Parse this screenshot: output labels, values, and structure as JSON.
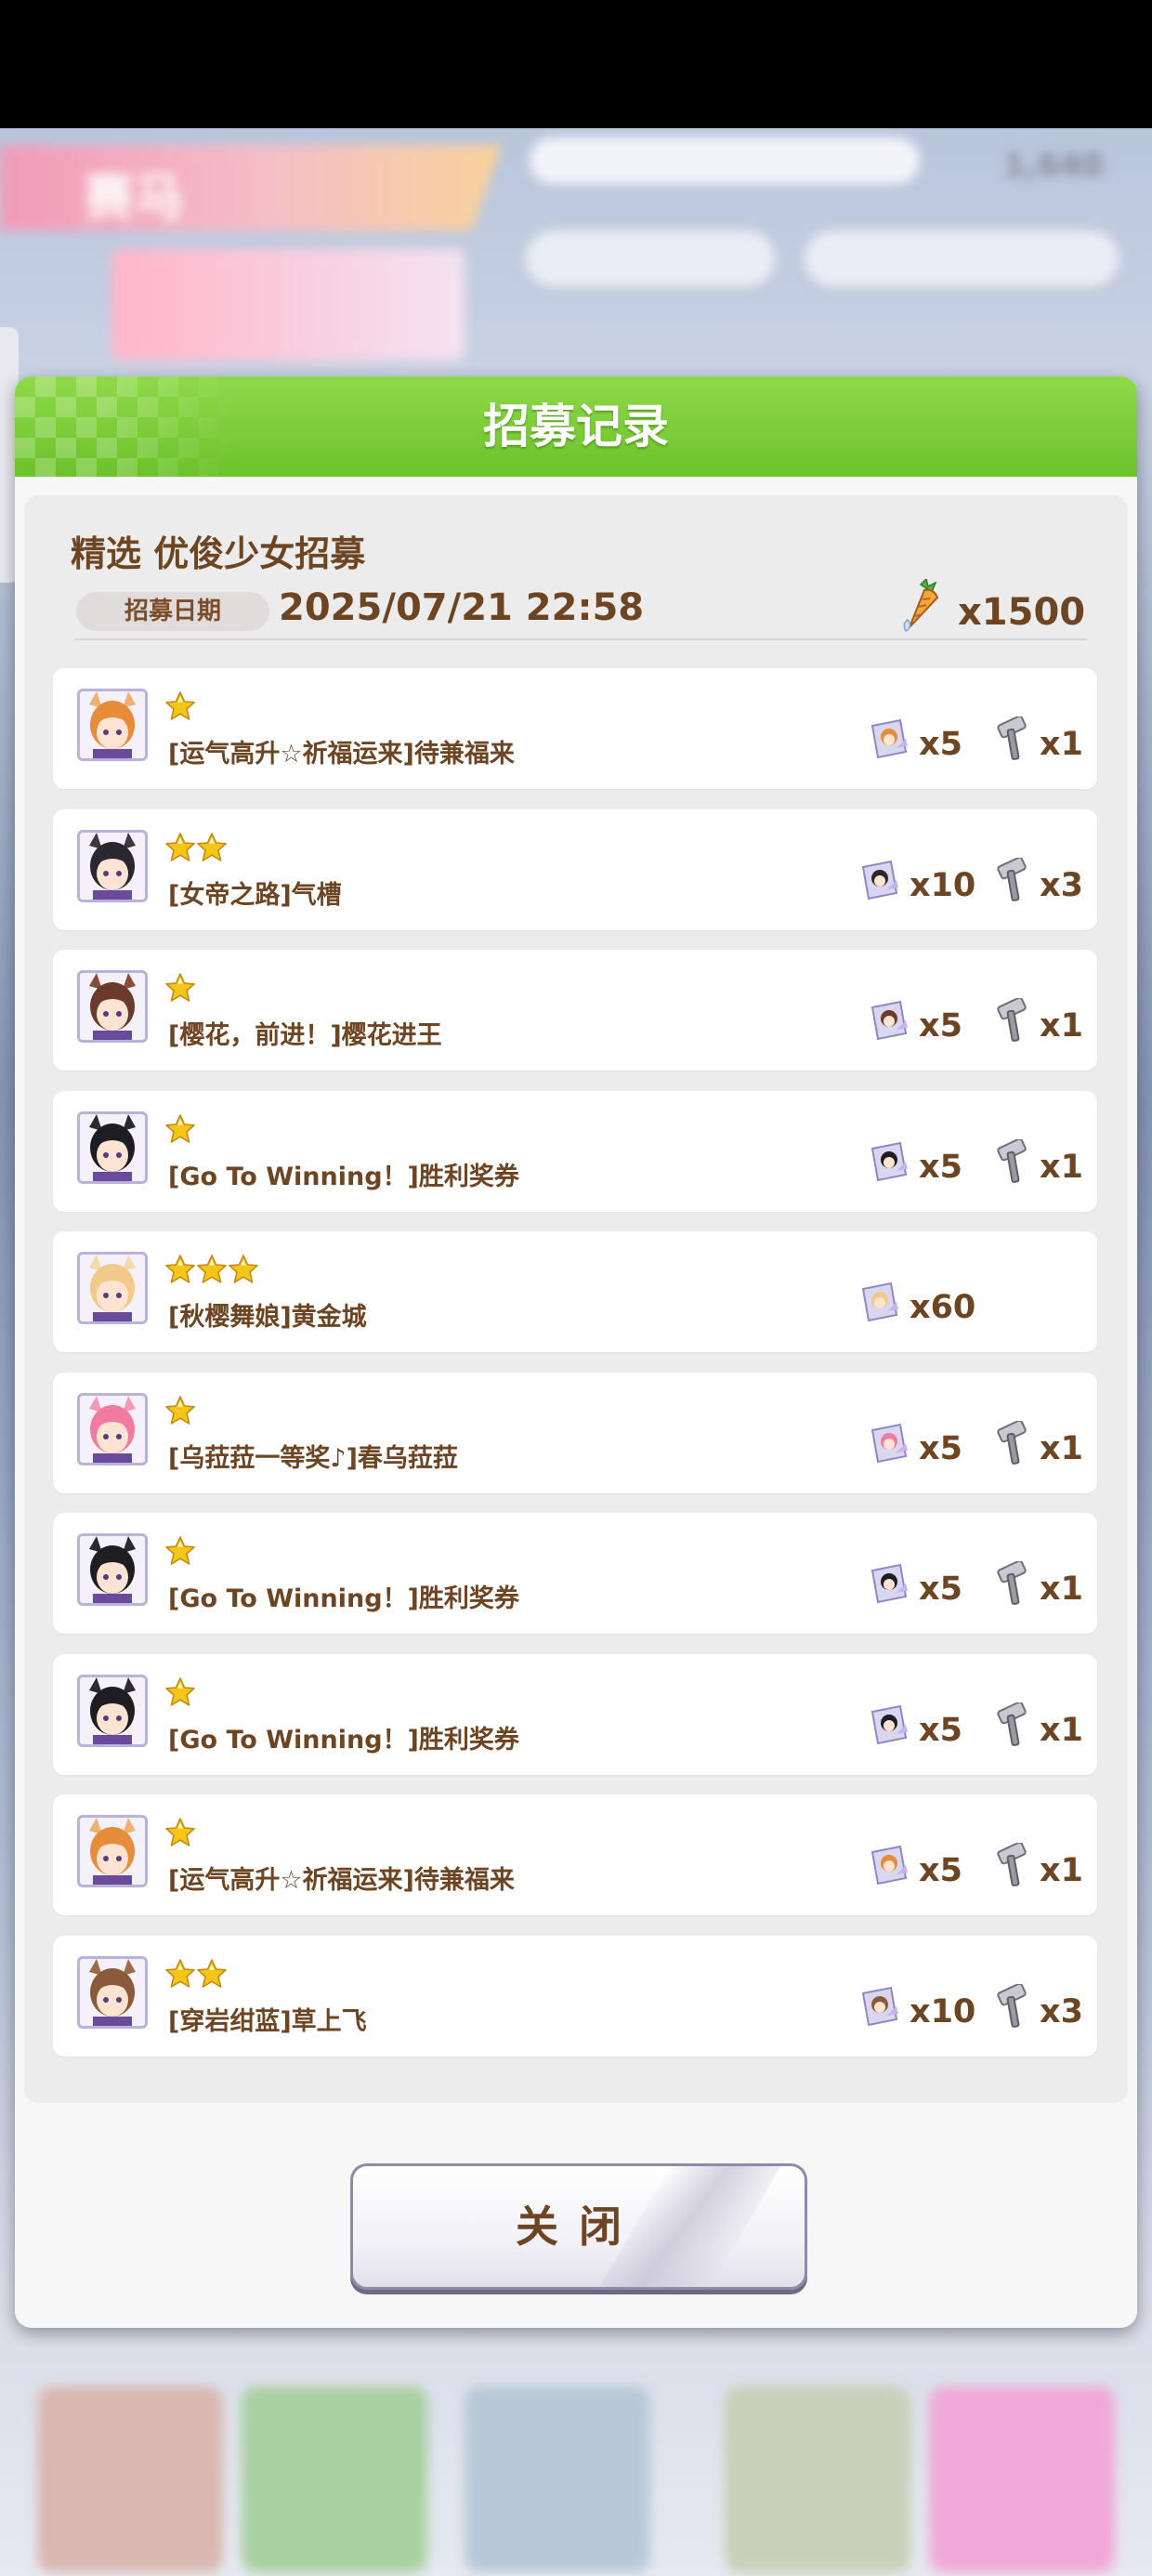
{
  "background": {
    "header_title": "赛马",
    "coin_count": "1,640"
  },
  "dialog": {
    "title": "招募记录",
    "banner_name": "精选 优俊少女招募",
    "date_label": "招募日期",
    "date_value": "2025/07/21 22:58",
    "cost": "x1500",
    "close_label": "关闭"
  },
  "records": [
    {
      "stars": 1,
      "name": "[运气高升☆祈福运来]待兼福来",
      "pieces": "x5",
      "hammers": "x1",
      "hair": "#e68c3a",
      "ear": "#f0b070"
    },
    {
      "stars": 2,
      "name": "[女帝之路]气槽",
      "pieces": "x10",
      "hammers": "x3",
      "hair": "#2b2730",
      "ear": "#3d3740"
    },
    {
      "stars": 1,
      "name": "[樱花，前进！]樱花进王",
      "pieces": "x5",
      "hammers": "x1",
      "hair": "#6b3a2a",
      "ear": "#8a4c36"
    },
    {
      "stars": 1,
      "name": "[Go To Winning！]胜利奖券",
      "pieces": "x5",
      "hammers": "x1",
      "hair": "#1d1d22",
      "ear": "#2a2a30"
    },
    {
      "stars": 3,
      "name": "[秋樱舞娘]黄金城",
      "pieces": "x60",
      "hammers": "",
      "hair": "#f2c98a",
      "ear": "#f6d9a8"
    },
    {
      "stars": 1,
      "name": "[乌菈菈一等奖♪]春乌菈菈",
      "pieces": "x5",
      "hammers": "x1",
      "hair": "#f07aa0",
      "ear": "#f29ab8"
    },
    {
      "stars": 1,
      "name": "[Go To Winning！]胜利奖券",
      "pieces": "x5",
      "hammers": "x1",
      "hair": "#1d1d22",
      "ear": "#2a2a30"
    },
    {
      "stars": 1,
      "name": "[Go To Winning！]胜利奖券",
      "pieces": "x5",
      "hammers": "x1",
      "hair": "#1d1d22",
      "ear": "#2a2a30"
    },
    {
      "stars": 1,
      "name": "[运气高升☆祈福运来]待兼福来",
      "pieces": "x5",
      "hammers": "x1",
      "hair": "#e68c3a",
      "ear": "#f0b070"
    },
    {
      "stars": 2,
      "name": "[穿岩绀蓝]草上飞",
      "pieces": "x10",
      "hammers": "x3",
      "hair": "#8a5a3a",
      "ear": "#a06c48"
    }
  ],
  "icons": {
    "cost": "carrot-icon",
    "pieces": "character-piece-icon",
    "hammers": "hammer-icon",
    "rarity": "star-icon"
  },
  "colors": {
    "header_green": "#7ccf38",
    "text_brown": "#6e4523",
    "star_gold": "#f5c518"
  }
}
